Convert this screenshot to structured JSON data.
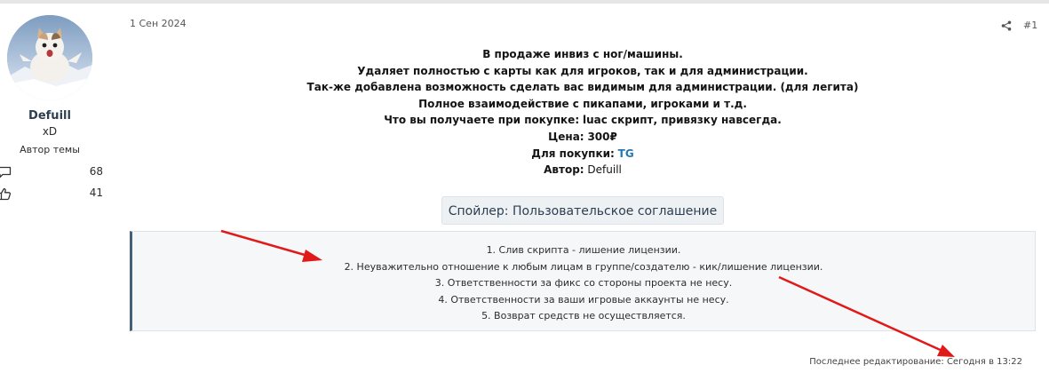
{
  "author": {
    "name": "Defuill",
    "title": "xD",
    "role": "Автор темы",
    "stats": [
      {
        "icon": "comment-icon",
        "value": "68"
      },
      {
        "icon": "thumbs-up-icon",
        "value": "41"
      }
    ]
  },
  "post": {
    "date": "1 Сен 2024",
    "number": "#1",
    "lines": [
      "В продаже инвиз с ног/машины.",
      "Удаляет полностью с карты как для игроков, так и для администрации.",
      "Так-же добавлена возможность сделать вас видимым для администрации. (для легита)",
      "Полное взаимодействие с пикапами, игроками и т.д."
    ],
    "purchase_label": "Что вы получаете при покупке:",
    "purchase_value": "luac скрипт, привязку навсегда.",
    "price_label": "Цена:",
    "price_value": "300₽",
    "contact_label": "Для покупки:",
    "contact_link": "TG",
    "author_label": "Автор:",
    "author_value": "Defuill"
  },
  "spoiler": {
    "button_label": "Спойлер: Пользовательское соглашение",
    "items": [
      "1. Слив скрипта - лишение лицензии.",
      "2. Неуважительно отношение к любым лицам в группе/создателю - кик/лишение лицензии.",
      "3. Ответственности за фикс со стороны проекта не несу.",
      "4. Ответственности за ваши игровые аккаунты не несу.",
      "5. Возврат средств не осуществляется."
    ]
  },
  "footer": {
    "last_edit": "Последнее редактирование: Сегодня в 13:22"
  },
  "colors": {
    "link": "#2577b1",
    "annotation_arrow": "#e01a1a",
    "spoiler_border": "#47607a"
  }
}
